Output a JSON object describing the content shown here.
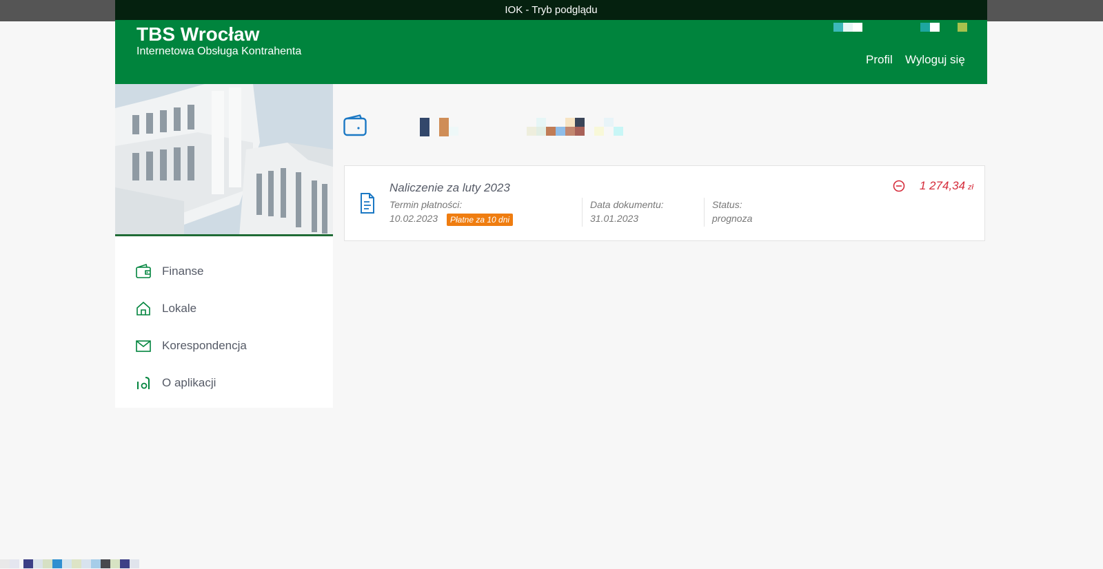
{
  "preview": {
    "title": "IOK - Tryb podglądu"
  },
  "header": {
    "brand_title": "TBS Wrocław",
    "brand_subtitle": "Internetowa Obsługa Kontrahenta",
    "nav": {
      "profile": "Profil",
      "logout": "Wyloguj się"
    }
  },
  "sidebar": {
    "items": [
      {
        "label": "Finanse",
        "icon": "wallet-icon"
      },
      {
        "label": "Lokale",
        "icon": "house-icon"
      },
      {
        "label": "Korespondencja",
        "icon": "envelope-icon"
      },
      {
        "label": "O aplikacji",
        "icon": "info-icon"
      }
    ]
  },
  "document": {
    "title": "Naliczenie za luty 2023",
    "payment_due_label": "Termin płatności:",
    "payment_due_value": "10.02.2023",
    "badge": "Płatne za 10 dni",
    "doc_date_label": "Data dokumentu:",
    "doc_date_value": "31.01.2023",
    "status_label": "Status:",
    "status_value": "prognoza",
    "amount": "1 274,34",
    "currency": "zł"
  },
  "colors": {
    "brand_green": "#00843d",
    "amount_red": "#d52b3a",
    "badge_orange": "#ef7d10",
    "icon_blue": "#1b78c4"
  }
}
